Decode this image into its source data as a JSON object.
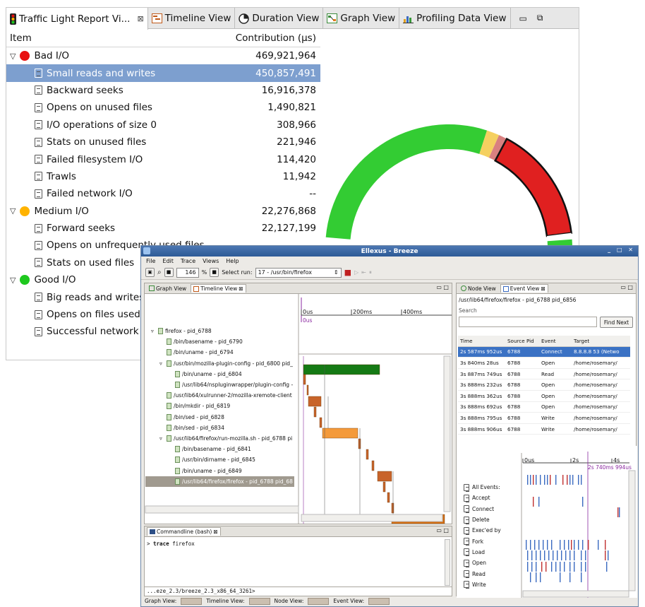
{
  "main_window": {
    "tabs": [
      {
        "label": "Traffic Light Report Vi...",
        "icon": "traffic-light-icon",
        "active": true
      },
      {
        "label": "Timeline View",
        "icon": "timeline-icon"
      },
      {
        "label": "Duration View",
        "icon": "pie-icon"
      },
      {
        "label": "Graph View",
        "icon": "graph-icon"
      },
      {
        "label": "Profiling Data View",
        "icon": "bar-chart-icon"
      }
    ],
    "close_glyph": "⊠",
    "columns": {
      "item": "Item",
      "contribution": "Contribution (µs)"
    },
    "rows": [
      {
        "label": "Bad I/O",
        "value": "469,921,964",
        "level": 0,
        "color": "#e81010"
      },
      {
        "label": "Small reads and writes",
        "value": "450,857,491",
        "level": 1,
        "selected": true
      },
      {
        "label": "Backward seeks",
        "value": "16,916,378",
        "level": 1
      },
      {
        "label": "Opens on unused files",
        "value": "1,490,821",
        "level": 1
      },
      {
        "label": "I/O operations of size 0",
        "value": "308,966",
        "level": 1
      },
      {
        "label": "Stats on unused files",
        "value": "221,946",
        "level": 1
      },
      {
        "label": "Failed filesystem I/O",
        "value": "114,420",
        "level": 1
      },
      {
        "label": "Trawls",
        "value": "11,942",
        "level": 1
      },
      {
        "label": "Failed network I/O",
        "value": "--",
        "level": 1
      },
      {
        "label": "Medium I/O",
        "value": "22,276,868",
        "level": 0,
        "color": "#ffb300"
      },
      {
        "label": "Forward seeks",
        "value": "22,127,199",
        "level": 1
      },
      {
        "label": "Opens on unfrequently used files",
        "value": "",
        "level": 1
      },
      {
        "label": "Stats on used files",
        "value": "",
        "level": 1
      },
      {
        "label": "Good I/O",
        "value": "",
        "level": 0,
        "color": "#1ec81e"
      },
      {
        "label": "Big reads and writes",
        "value": "",
        "level": 1
      },
      {
        "label": "Opens on files used",
        "value": "",
        "level": 1
      },
      {
        "label": "Successful network I/O",
        "value": "",
        "level": 1
      }
    ],
    "donut": {
      "green": "#33cc33",
      "red": "#e02020",
      "yellow": "#f5d060",
      "pink": "#d98080"
    }
  },
  "breeze": {
    "title": "Ellexus - Breeze",
    "menu": [
      "File",
      "Edit",
      "Trace",
      "Views",
      "Help"
    ],
    "zoom": "146",
    "zoom_unit": "%",
    "select_run_label": "Select run:",
    "select_run_value": "17 - /usr/bin/firefox",
    "left_tabs": [
      "Graph View",
      "Timeline View"
    ],
    "timeline_ticks": [
      "0us",
      "200ms",
      "400ms"
    ],
    "cursor_label": "0us",
    "tree": [
      {
        "label": "firefox - pid_6788",
        "depth": 0,
        "expanded": true
      },
      {
        "label": "/bin/basename - pid_6790",
        "depth": 1
      },
      {
        "label": "/bin/uname - pid_6794",
        "depth": 1
      },
      {
        "label": "/usr/bin/mozilla-plugin-config - pid_6800 pid_",
        "depth": 1,
        "expanded": true
      },
      {
        "label": "/bin/uname - pid_6804",
        "depth": 2
      },
      {
        "label": "/usr/lib64/nspluginwrapper/plugin-config -",
        "depth": 2
      },
      {
        "label": "/usr/lib64/xulrunner-2/mozilla-xremote-client",
        "depth": 1
      },
      {
        "label": "/bin/mkdir - pid_6819",
        "depth": 1
      },
      {
        "label": "/bin/sed - pid_6828",
        "depth": 1
      },
      {
        "label": "/bin/sed - pid_6834",
        "depth": 1
      },
      {
        "label": "/usr/lib64/firefox/run-mozilla.sh - pid_6788 pi",
        "depth": 1,
        "expanded": true
      },
      {
        "label": "/bin/basename - pid_6841",
        "depth": 2
      },
      {
        "label": "/usr/bin/dirname - pid_6845",
        "depth": 2
      },
      {
        "label": "/bin/uname - pid_6849",
        "depth": 2
      },
      {
        "label": "/usr/lib64/firefox/firefox - pid_6788 pid_68",
        "depth": 2,
        "highlight": true
      }
    ],
    "console": {
      "tab": "Commandline (bash)",
      "prompt": ">",
      "command": "trace",
      "arg": "firefox",
      "path": "...eze_2.3/breeze_2.3_x86_64_3261>"
    },
    "right_tabs": [
      "Node View",
      "Event View"
    ],
    "node_title": "/usr/lib64/firefox/firefox - pid_6788 pid_6856",
    "search_label": "Search",
    "find_next": "Find Next",
    "event_columns": [
      "Time",
      "Source Pid",
      "Event",
      "Target"
    ],
    "events": [
      {
        "time": "2s 587ms 952us",
        "pid": "6788",
        "event": "Connect",
        "target": "8.8.8.8 53 (Netwo",
        "selected": true
      },
      {
        "time": "3s 840ms 28us",
        "pid": "6788",
        "event": "Open",
        "target": "/home/rosemary/"
      },
      {
        "time": "3s 887ms 749us",
        "pid": "6788",
        "event": "Read",
        "target": "/home/rosemary/"
      },
      {
        "time": "3s 888ms 232us",
        "pid": "6788",
        "event": "Open",
        "target": "/home/rosemary/"
      },
      {
        "time": "3s 888ms 362us",
        "pid": "6788",
        "event": "Open",
        "target": "/home/rosemary/"
      },
      {
        "time": "3s 888ms 692us",
        "pid": "6788",
        "event": "Open",
        "target": "/home/rosemary/"
      },
      {
        "time": "3s 888ms 795us",
        "pid": "6788",
        "event": "Write",
        "target": "/home/rosemary/"
      },
      {
        "time": "3s 888ms 906us",
        "pid": "6788",
        "event": "Write",
        "target": "/home/rosemary/"
      }
    ],
    "event_ticks": [
      "0us",
      "2s",
      "4s"
    ],
    "event_cursor": "2s 740ms 994us",
    "categories": [
      "All Events:",
      "Accept",
      "Connect",
      "Delete",
      "Exec'ed by",
      "Fork",
      "Load",
      "Open",
      "Read",
      "Write"
    ],
    "status": [
      "Graph View:",
      "Timeline View:",
      "Node View:",
      "Event View:"
    ]
  }
}
